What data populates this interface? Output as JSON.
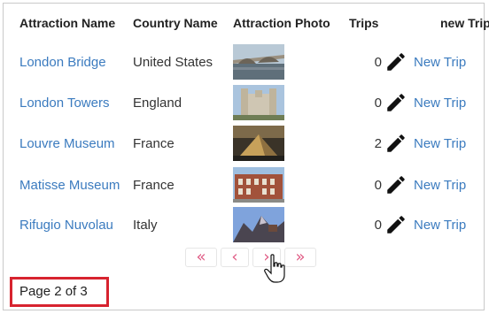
{
  "columns": {
    "attraction_name": "Attraction Name",
    "country_name": "Country Name",
    "attraction_photo": "Attraction Photo",
    "trips": "Trips",
    "new_trip": "new Trip"
  },
  "rows": [
    {
      "attraction": "London Bridge",
      "country": "United States",
      "trips": "0",
      "new_trip": "New Trip",
      "photo_icon": "bridge-photo-icon"
    },
    {
      "attraction": "London Towers",
      "country": "England",
      "trips": "0",
      "new_trip": "New Trip",
      "photo_icon": "tower-photo-icon"
    },
    {
      "attraction": "Louvre Museum",
      "country": "France",
      "trips": "2",
      "new_trip": "New Trip",
      "photo_icon": "pyramid-photo-icon"
    },
    {
      "attraction": "Matisse Museum",
      "country": "France",
      "trips": "0",
      "new_trip": "New Trip",
      "photo_icon": "museum-photo-icon"
    },
    {
      "attraction": "Rifugio Nuvolau",
      "country": "Italy",
      "trips": "0",
      "new_trip": "New Trip",
      "photo_icon": "mountain-photo-icon"
    }
  ],
  "pager": {
    "first": "«",
    "prev": "‹",
    "next": "›",
    "last": "»"
  },
  "page_info": "Page 2 of 3",
  "colors": {
    "link": "#3b7bbf",
    "pager_accent": "#e05a84",
    "highlight_border": "#d7232f"
  }
}
